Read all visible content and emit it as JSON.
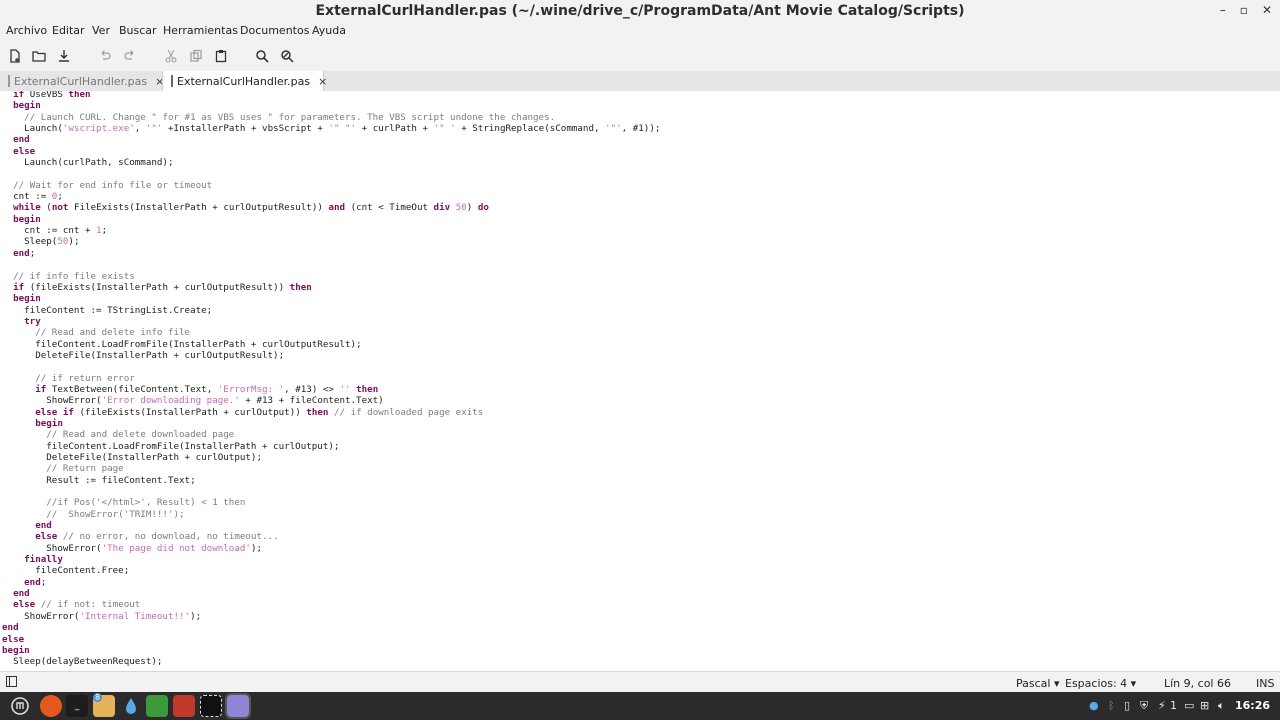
{
  "window": {
    "title": "ExternalCurlHandler.pas (~/.wine/drive_c/ProgramData/Ant Movie Catalog/Scripts)"
  },
  "menu": [
    "Archivo",
    "Editar",
    "Ver",
    "Buscar",
    "Herramientas",
    "Documentos",
    "Ayuda"
  ],
  "toolbar": [
    "new-document-icon",
    "open-icon",
    "save-download-icon",
    "undo-icon",
    "redo-icon",
    "cut-icon",
    "copy-icon",
    "paste-icon",
    "search-icon",
    "replace-icon"
  ],
  "tabs": [
    {
      "label": "ExternalCurlHandler.pas",
      "close": "×",
      "active": false
    },
    {
      "label": "ExternalCurlHandler.pas",
      "close": "×",
      "active": true
    }
  ],
  "code_lines": [
    [
      [
        "  ",
        "t"
      ],
      [
        "if",
        "k"
      ],
      [
        " UseVBS ",
        "t"
      ],
      [
        "then",
        "k"
      ]
    ],
    [
      [
        "  ",
        "t"
      ],
      [
        "begin",
        "k"
      ]
    ],
    [
      [
        "    ",
        "t"
      ],
      [
        "// Launch CURL. Change \" for #1 as VBS uses \" for parameters. The VBS script undone the changes.",
        "c"
      ]
    ],
    [
      [
        "    Launch(",
        "t"
      ],
      [
        "'wscript.exe'",
        "s"
      ],
      [
        ", ",
        "t"
      ],
      [
        "'\"'",
        "s"
      ],
      [
        " +InstallerPath + vbsScript + ",
        "t"
      ],
      [
        "'\" \"'",
        "s"
      ],
      [
        " + curlPath + ",
        "t"
      ],
      [
        "'\" '",
        "s"
      ],
      [
        " + StringReplace(sCommand, ",
        "t"
      ],
      [
        "'\"'",
        "s"
      ],
      [
        ", #1));",
        "t"
      ]
    ],
    [
      [
        "  ",
        "t"
      ],
      [
        "end",
        "k"
      ]
    ],
    [
      [
        "  ",
        "t"
      ],
      [
        "else",
        "k"
      ]
    ],
    [
      [
        "    Launch(curlPath, sCommand);",
        "t"
      ]
    ],
    [
      [
        "",
        "t"
      ]
    ],
    [
      [
        "  ",
        "t"
      ],
      [
        "// Wait for end info file or timeout",
        "c"
      ]
    ],
    [
      [
        "  cnt := ",
        "t"
      ],
      [
        "0",
        "s"
      ],
      [
        ";",
        "t"
      ]
    ],
    [
      [
        "  ",
        "t"
      ],
      [
        "while",
        "k"
      ],
      [
        " (",
        "t"
      ],
      [
        "not",
        "k"
      ],
      [
        " FileExists(InstallerPath + curlOutputResult)) ",
        "t"
      ],
      [
        "and",
        "k"
      ],
      [
        " (cnt < TimeOut ",
        "t"
      ],
      [
        "div",
        "k"
      ],
      [
        " ",
        "t"
      ],
      [
        "50",
        "s"
      ],
      [
        ") ",
        "t"
      ],
      [
        "do",
        "k"
      ]
    ],
    [
      [
        "  ",
        "t"
      ],
      [
        "begin",
        "k"
      ]
    ],
    [
      [
        "    cnt := cnt + ",
        "t"
      ],
      [
        "1",
        "s"
      ],
      [
        ";",
        "t"
      ]
    ],
    [
      [
        "    Sleep(",
        "t"
      ],
      [
        "50",
        "s"
      ],
      [
        ");",
        "t"
      ]
    ],
    [
      [
        "  ",
        "t"
      ],
      [
        "end",
        "k"
      ],
      [
        ";",
        "t"
      ]
    ],
    [
      [
        "",
        "t"
      ]
    ],
    [
      [
        "  ",
        "t"
      ],
      [
        "// if info file exists",
        "c"
      ]
    ],
    [
      [
        "  ",
        "t"
      ],
      [
        "if",
        "k"
      ],
      [
        " (fileExists(InstallerPath + curlOutputResult)) ",
        "t"
      ],
      [
        "then",
        "k"
      ]
    ],
    [
      [
        "  ",
        "t"
      ],
      [
        "begin",
        "k"
      ]
    ],
    [
      [
        "    fileContent := TStringList.Create;",
        "t"
      ]
    ],
    [
      [
        "    ",
        "t"
      ],
      [
        "try",
        "k"
      ]
    ],
    [
      [
        "      ",
        "t"
      ],
      [
        "// Read and delete info file",
        "c"
      ]
    ],
    [
      [
        "      fileContent.LoadFromFile(InstallerPath + curlOutputResult);",
        "t"
      ]
    ],
    [
      [
        "      DeleteFile(InstallerPath + curlOutputResult);",
        "t"
      ]
    ],
    [
      [
        "",
        "t"
      ]
    ],
    [
      [
        "      ",
        "t"
      ],
      [
        "// if return error",
        "c"
      ]
    ],
    [
      [
        "      ",
        "t"
      ],
      [
        "if",
        "k"
      ],
      [
        " TextBetween(fileContent.Text, ",
        "t"
      ],
      [
        "'ErrorMsg: '",
        "s"
      ],
      [
        ", #13) <> ",
        "t"
      ],
      [
        "''",
        "s"
      ],
      [
        " ",
        "t"
      ],
      [
        "then",
        "k"
      ]
    ],
    [
      [
        "        ShowError(",
        "t"
      ],
      [
        "'Error downloading page.'",
        "s"
      ],
      [
        " + #13 + fileContent.Text)",
        "t"
      ]
    ],
    [
      [
        "      ",
        "t"
      ],
      [
        "else",
        "k"
      ],
      [
        " ",
        "t"
      ],
      [
        "if",
        "k"
      ],
      [
        " (fileExists(InstallerPath + curlOutput)) ",
        "t"
      ],
      [
        "then",
        "k"
      ],
      [
        " ",
        "t"
      ],
      [
        "// if downloaded page exits",
        "c"
      ]
    ],
    [
      [
        "      ",
        "t"
      ],
      [
        "begin",
        "k"
      ]
    ],
    [
      [
        "        ",
        "t"
      ],
      [
        "// Read and delete downloaded page",
        "c"
      ]
    ],
    [
      [
        "        fileContent.LoadFromFile(InstallerPath + curlOutput);",
        "t"
      ]
    ],
    [
      [
        "        DeleteFile(InstallerPath + curlOutput);",
        "t"
      ]
    ],
    [
      [
        "        ",
        "t"
      ],
      [
        "// Return page",
        "c"
      ]
    ],
    [
      [
        "        Result := fileContent.Text;",
        "t"
      ]
    ],
    [
      [
        "",
        "t"
      ]
    ],
    [
      [
        "        ",
        "t"
      ],
      [
        "//if Pos('</html>', Result) < 1 then",
        "c"
      ]
    ],
    [
      [
        "        ",
        "t"
      ],
      [
        "//  ShowError('TRIM!!!');",
        "c"
      ]
    ],
    [
      [
        "      ",
        "t"
      ],
      [
        "end",
        "k"
      ]
    ],
    [
      [
        "      ",
        "t"
      ],
      [
        "else",
        "k"
      ],
      [
        " ",
        "t"
      ],
      [
        "// no error, no download, no timeout...",
        "c"
      ]
    ],
    [
      [
        "        ShowError(",
        "t"
      ],
      [
        "'The page did not download'",
        "s"
      ],
      [
        ");",
        "t"
      ]
    ],
    [
      [
        "    ",
        "t"
      ],
      [
        "finally",
        "k"
      ]
    ],
    [
      [
        "      fileContent.Free;",
        "t"
      ]
    ],
    [
      [
        "    ",
        "t"
      ],
      [
        "end",
        "k"
      ],
      [
        ";",
        "t"
      ]
    ],
    [
      [
        "  ",
        "t"
      ],
      [
        "end",
        "k"
      ]
    ],
    [
      [
        "  ",
        "t"
      ],
      [
        "else",
        "k"
      ],
      [
        " ",
        "t"
      ],
      [
        "// if not: timeout",
        "c"
      ]
    ],
    [
      [
        "    ShowError(",
        "t"
      ],
      [
        "'Internal Timeout!!'",
        "s"
      ],
      [
        ");",
        "t"
      ]
    ],
    [
      [
        "end",
        "k"
      ]
    ],
    [
      [
        "else",
        "k"
      ]
    ],
    [
      [
        "begin",
        "k"
      ]
    ],
    [
      [
        "  Sleep(delayBetweenRequest);",
        "t"
      ]
    ]
  ],
  "status": {
    "language": "Pascal",
    "spaces": "Espacios: 4",
    "position": "Lín 9, col 66",
    "mode": "INS"
  },
  "taskbar": {
    "apps": [
      "menu-icon",
      "firefox-icon",
      "terminal-icon",
      "files-icon",
      "drop-icon",
      "inkscape-icon",
      "gimp-icon",
      "video-icon",
      "text-editor-icon"
    ],
    "badge": "8",
    "tray_count": "1",
    "clock": "16:26"
  }
}
